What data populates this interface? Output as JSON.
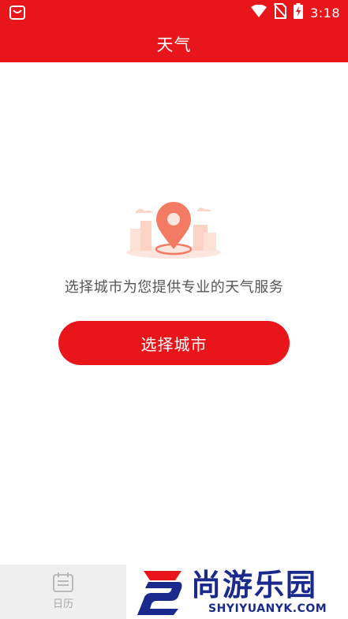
{
  "status_bar": {
    "time": "3:18"
  },
  "app_bar": {
    "title": "天气"
  },
  "empty_state": {
    "message": "选择城市为您提供专业的天气服务",
    "button_label": "选择城市"
  },
  "bottom_nav": {
    "items": [
      {
        "label": "日历",
        "icon": "calendar-icon"
      }
    ]
  },
  "watermark": {
    "name": "尚游乐园",
    "domain": "SHYIYUANYK.COM"
  },
  "colors": {
    "brand_red": "#e8151b",
    "illustration_pin": "#f47b63",
    "watermark_blue": "#1a2a8c"
  }
}
